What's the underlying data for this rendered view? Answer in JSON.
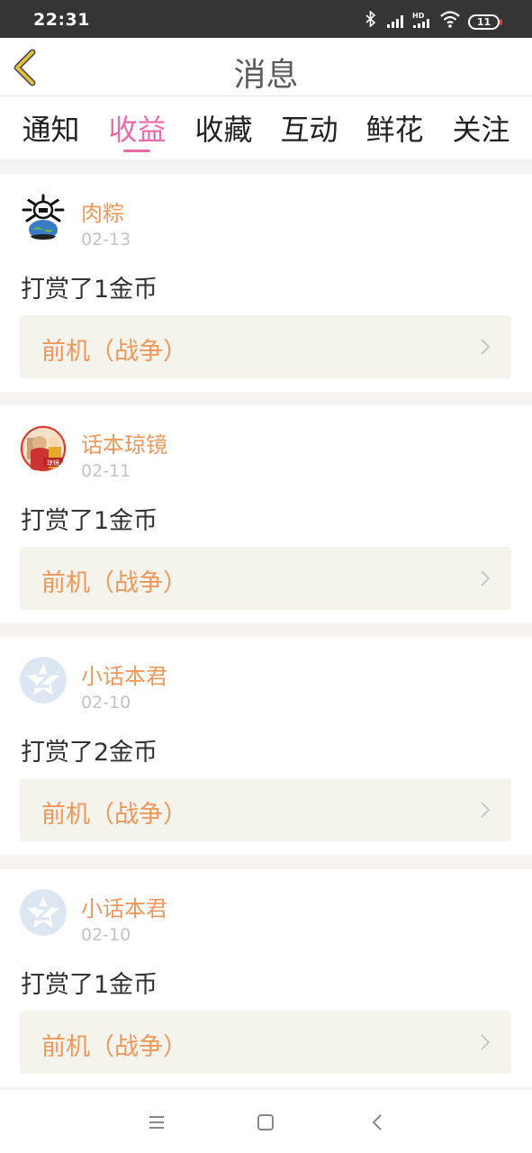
{
  "status_bar": {
    "time": "22:31",
    "battery": "11",
    "hd": "HD"
  },
  "header": {
    "title": "消息"
  },
  "tabs": [
    {
      "label": "通知",
      "active": false
    },
    {
      "label": "收益",
      "active": true
    },
    {
      "label": "收藏",
      "active": false
    },
    {
      "label": "互动",
      "active": false
    },
    {
      "label": "鲜花",
      "active": false
    },
    {
      "label": "关注",
      "active": false
    }
  ],
  "notifications": [
    {
      "user": "肉粽",
      "date": "02-13",
      "message": "打赏了1金币",
      "book": "前机（战争）",
      "avatar": "skull-globe-avatar"
    },
    {
      "user": "话本琼镜",
      "date": "02-11",
      "message": "打赏了1金币",
      "book": "前机（战争）",
      "avatar": "character-avatar"
    },
    {
      "user": "小话本君",
      "date": "02-10",
      "message": "打赏了2金币",
      "book": "前机（战争）",
      "avatar": "default-z-avatar"
    },
    {
      "user": "小话本君",
      "date": "02-10",
      "message": "打赏了1金币",
      "book": "前机（战争）",
      "avatar": "default-z-avatar"
    }
  ],
  "colors": {
    "accent_pink": "#e96aa5",
    "accent_orange": "#f0985c",
    "back_yellow": "#e8c23a"
  }
}
